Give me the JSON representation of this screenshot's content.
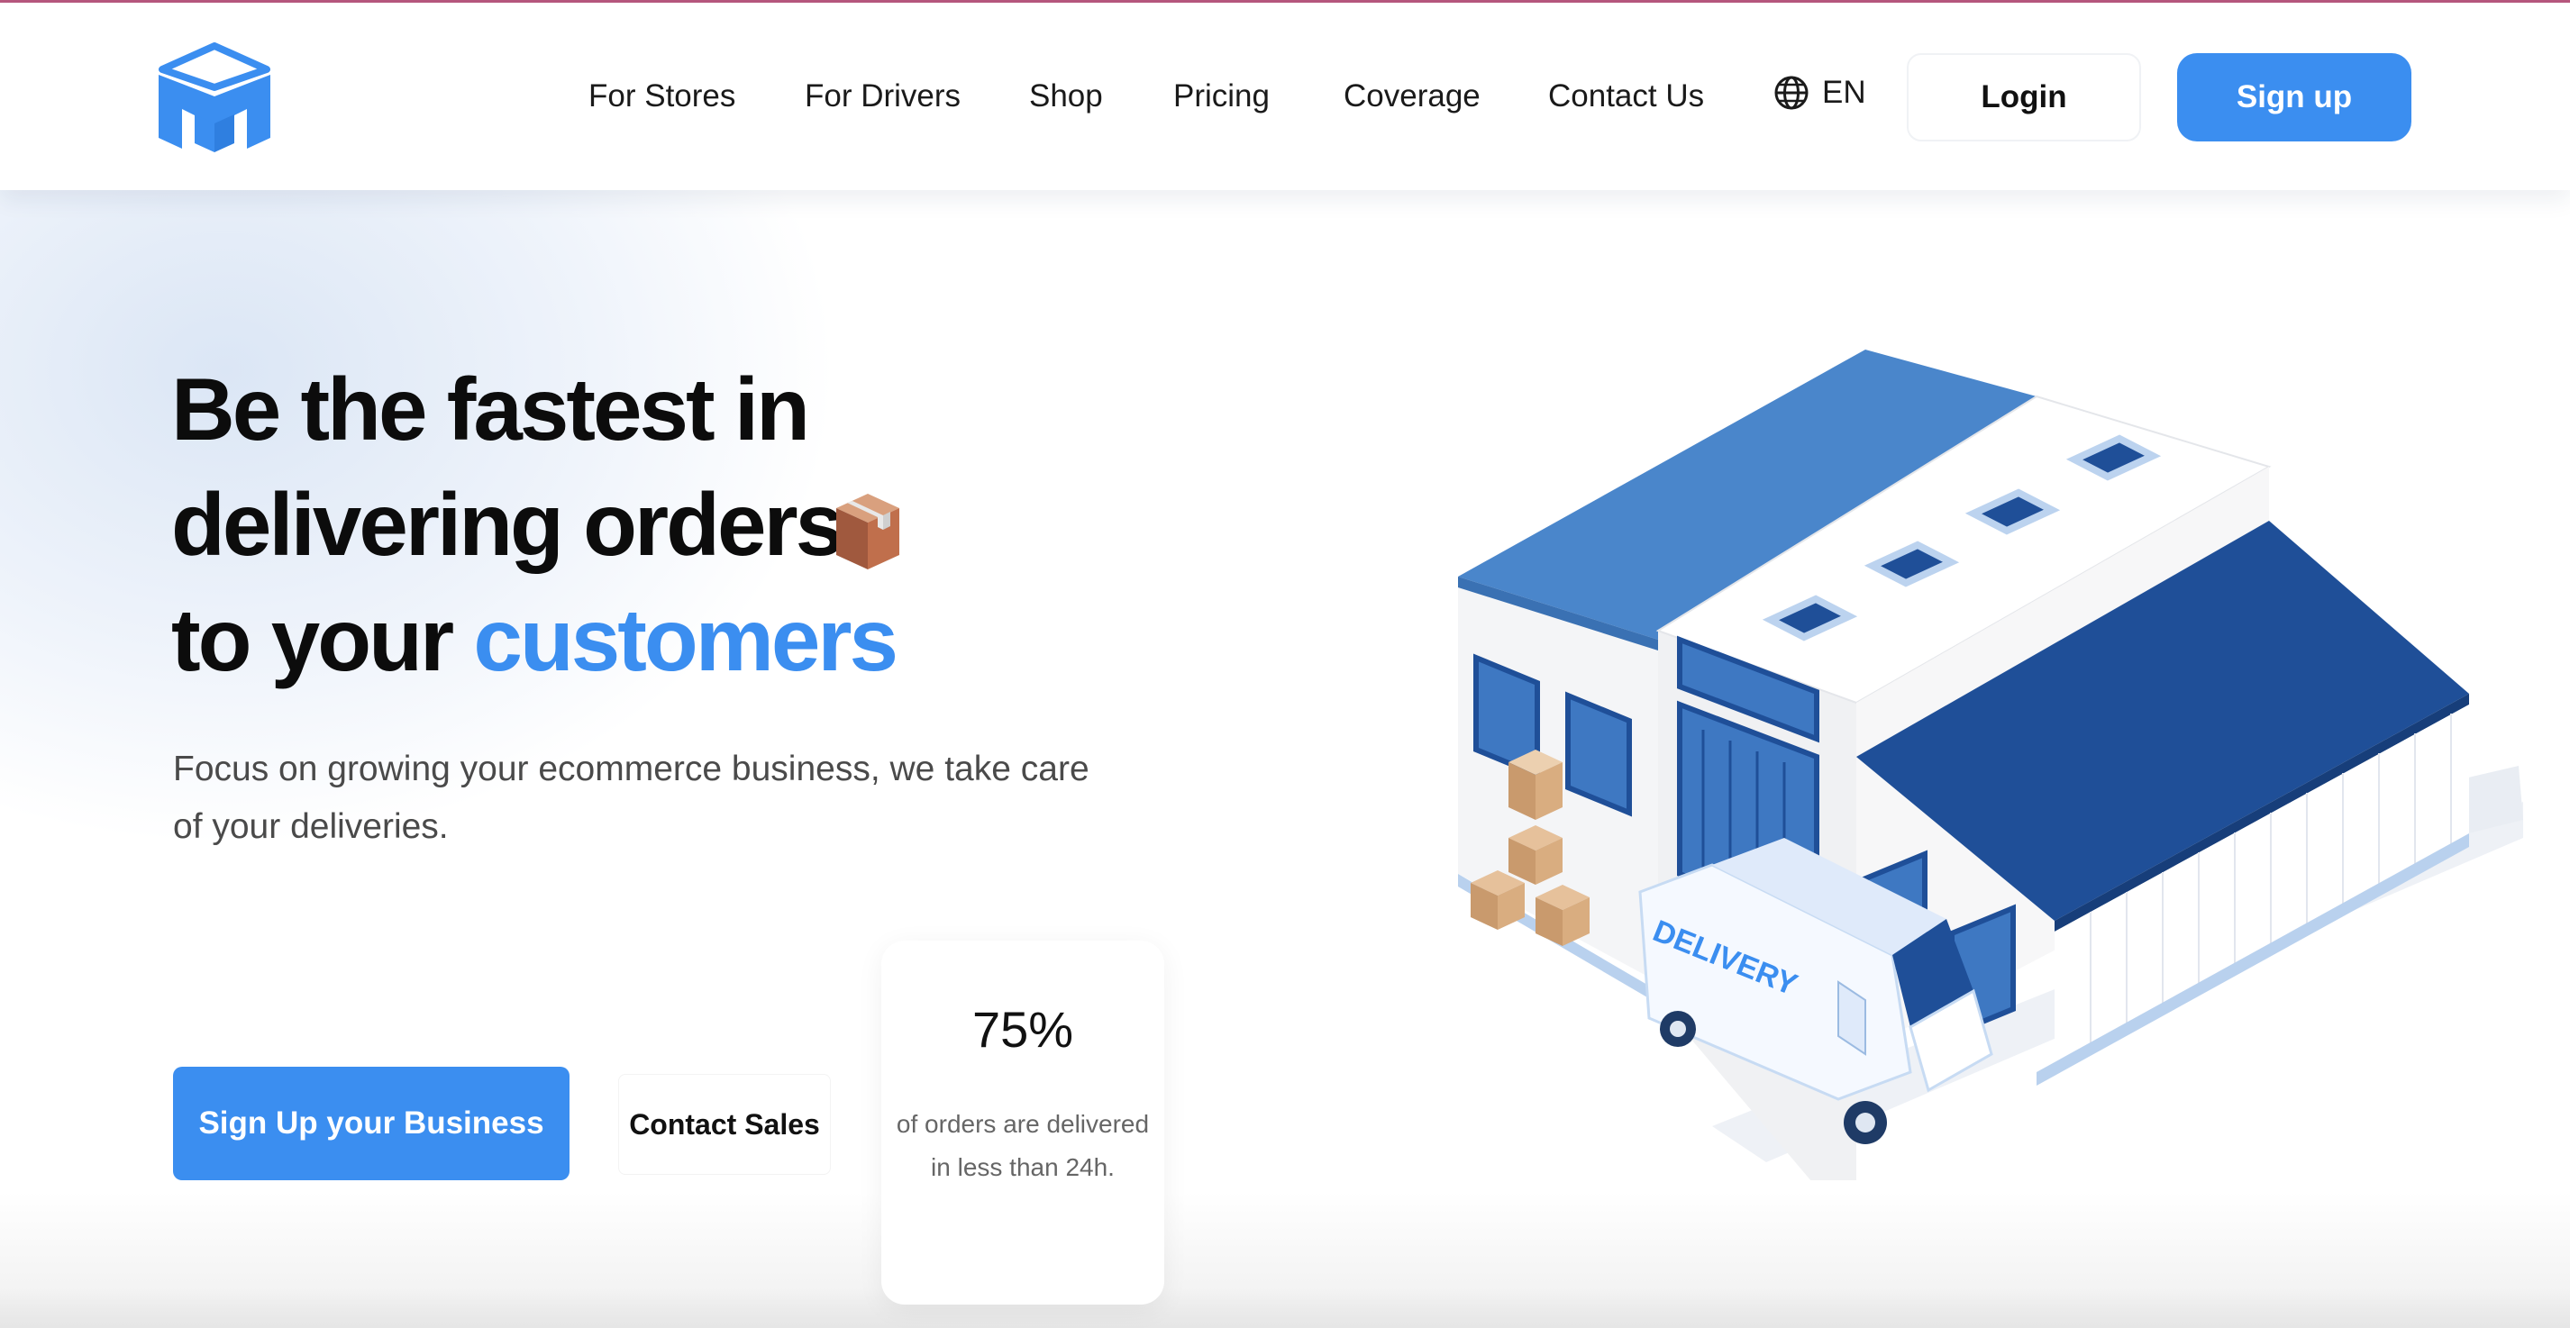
{
  "brand": {
    "primary_color": "#3b8ef0",
    "dark_blue": "#1f4f98",
    "logo_icon": "m-cube-logo-icon"
  },
  "nav": {
    "links": [
      "For Stores",
      "For Drivers",
      "Shop",
      "Pricing",
      "Coverage",
      "Contact Us"
    ],
    "language": "EN",
    "language_icon": "globe-icon",
    "login": "Login",
    "signup": "Sign up"
  },
  "hero": {
    "headline_line1": "Be the fastest in",
    "headline_line2": "delivering orders",
    "headline_line3_prefix": "to your ",
    "headline_line3_accent": "customers",
    "headline_icon": "package-icon",
    "subtext": "Focus on growing your ecommerce business, we take care of your deliveries.",
    "cta_primary": "Sign Up your Business",
    "cta_secondary": "Contact Sales"
  },
  "stat": {
    "value": "75%",
    "description": "of orders are delivered in less than 24h."
  },
  "illustration": {
    "van_label": "DELIVERY"
  }
}
